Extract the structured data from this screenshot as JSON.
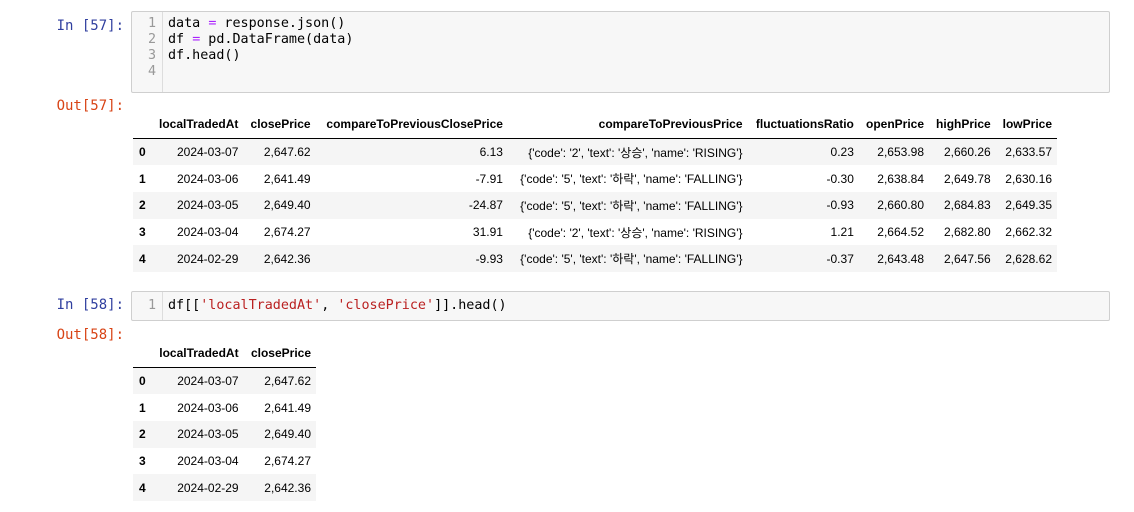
{
  "cells": [
    {
      "in_prompt": "In [57]:",
      "out_prompt": "Out[57]:",
      "code": [
        {
          "n": "1",
          "parts": [
            {
              "t": "data ",
              "c": ""
            },
            {
              "t": "=",
              "c": "op"
            },
            {
              "t": " response.json()",
              "c": ""
            }
          ]
        },
        {
          "n": "2",
          "parts": [
            {
              "t": "df ",
              "c": ""
            },
            {
              "t": "=",
              "c": "op"
            },
            {
              "t": " pd.DataFrame(data)",
              "c": ""
            }
          ]
        },
        {
          "n": "3",
          "parts": [
            {
              "t": "df.head()",
              "c": ""
            }
          ]
        },
        {
          "n": "4",
          "parts": []
        }
      ],
      "table": {
        "columns": [
          "",
          "localTradedAt",
          "closePrice",
          "compareToPreviousClosePrice",
          "compareToPreviousPrice",
          "fluctuationsRatio",
          "openPrice",
          "highPrice",
          "lowPrice"
        ],
        "rows": [
          [
            "0",
            "2024-03-07",
            "2,647.62",
            "6.13",
            "{'code': '2', 'text': '상승', 'name': 'RISING'}",
            "0.23",
            "2,653.98",
            "2,660.26",
            "2,633.57"
          ],
          [
            "1",
            "2024-03-06",
            "2,641.49",
            "-7.91",
            "{'code': '5', 'text': '하락', 'name': 'FALLING'}",
            "-0.30",
            "2,638.84",
            "2,649.78",
            "2,630.16"
          ],
          [
            "2",
            "2024-03-05",
            "2,649.40",
            "-24.87",
            "{'code': '5', 'text': '하락', 'name': 'FALLING'}",
            "-0.93",
            "2,660.80",
            "2,684.83",
            "2,649.35"
          ],
          [
            "3",
            "2024-03-04",
            "2,674.27",
            "31.91",
            "{'code': '2', 'text': '상승', 'name': 'RISING'}",
            "1.21",
            "2,664.52",
            "2,682.80",
            "2,662.32"
          ],
          [
            "4",
            "2024-02-29",
            "2,642.36",
            "-9.93",
            "{'code': '5', 'text': '하락', 'name': 'FALLING'}",
            "-0.37",
            "2,643.48",
            "2,647.56",
            "2,628.62"
          ]
        ]
      }
    },
    {
      "in_prompt": "In [58]:",
      "out_prompt": "Out[58]:",
      "code": [
        {
          "n": "1",
          "parts": [
            {
              "t": "df[[",
              "c": ""
            },
            {
              "t": "'localTradedAt'",
              "c": "str"
            },
            {
              "t": ", ",
              "c": ""
            },
            {
              "t": "'closePrice'",
              "c": "str"
            },
            {
              "t": "]].head()",
              "c": ""
            }
          ]
        }
      ],
      "table": {
        "columns": [
          "",
          "localTradedAt",
          "closePrice"
        ],
        "rows": [
          [
            "0",
            "2024-03-07",
            "2,647.62"
          ],
          [
            "1",
            "2024-03-06",
            "2,641.49"
          ],
          [
            "2",
            "2024-03-05",
            "2,649.40"
          ],
          [
            "3",
            "2024-03-04",
            "2,674.27"
          ],
          [
            "4",
            "2024-02-29",
            "2,642.36"
          ]
        ]
      }
    }
  ],
  "colors": {
    "in_prompt": "#303f9f",
    "out_prompt": "#d84315",
    "keyword_operator": "#aa22ff",
    "string": "#ba2121"
  }
}
